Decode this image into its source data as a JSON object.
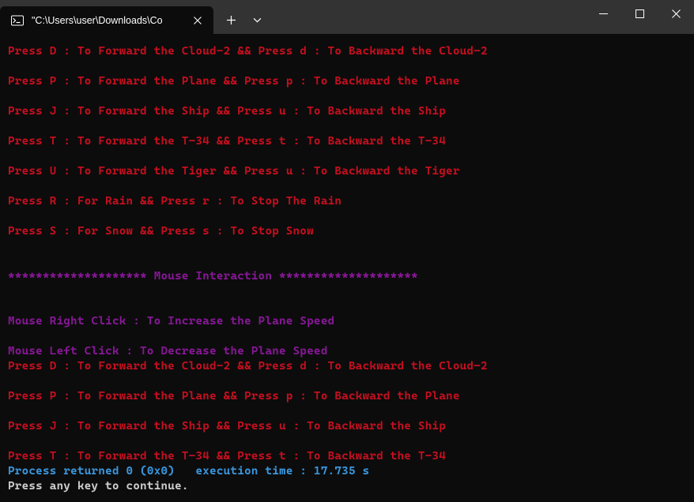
{
  "titlebar": {
    "tab_title": "\"C:\\Users\\user\\Downloads\\Co"
  },
  "terminal": {
    "lines": [
      {
        "cls": "red",
        "text": "Press D : To Forward the Cloud-2 && Press d : To Backward the Cloud-2"
      },
      {
        "cls": "spacer",
        "text": ""
      },
      {
        "cls": "red",
        "text": "Press P : To Forward the Plane && Press p : To Backward the Plane"
      },
      {
        "cls": "spacer",
        "text": ""
      },
      {
        "cls": "red",
        "text": "Press J : To Forward the Ship && Press u : To Backward the Ship"
      },
      {
        "cls": "spacer",
        "text": ""
      },
      {
        "cls": "red",
        "text": "Press T : To Forward the T-34 && Press t : To Backward the T-34"
      },
      {
        "cls": "spacer",
        "text": ""
      },
      {
        "cls": "red",
        "text": "Press U : To Forward the Tiger && Press u : To Backward the Tiger"
      },
      {
        "cls": "spacer",
        "text": ""
      },
      {
        "cls": "red",
        "text": "Press R : For Rain && Press r : To Stop The Rain"
      },
      {
        "cls": "spacer",
        "text": ""
      },
      {
        "cls": "red",
        "text": "Press S : For Snow && Press s : To Stop Snow"
      },
      {
        "cls": "spacer",
        "text": ""
      },
      {
        "cls": "spacer",
        "text": ""
      },
      {
        "cls": "magenta",
        "text": "******************** Mouse Interaction ********************"
      },
      {
        "cls": "spacer",
        "text": ""
      },
      {
        "cls": "spacer",
        "text": ""
      },
      {
        "cls": "magenta",
        "text": "Mouse Right Click : To Increase the Plane Speed"
      },
      {
        "cls": "spacer",
        "text": ""
      },
      {
        "cls": "magenta",
        "text": "Mouse Left Click : To Decrease the Plane Speed"
      },
      {
        "cls": "red",
        "text": "Press D : To Forward the Cloud-2 && Press d : To Backward the Cloud-2"
      },
      {
        "cls": "spacer",
        "text": ""
      },
      {
        "cls": "red",
        "text": "Press P : To Forward the Plane && Press p : To Backward the Plane"
      },
      {
        "cls": "spacer",
        "text": ""
      },
      {
        "cls": "red",
        "text": "Press J : To Forward the Ship && Press u : To Backward the Ship"
      },
      {
        "cls": "spacer",
        "text": ""
      },
      {
        "cls": "red",
        "text": "Press T : To Forward the T-34 && Press t : To Backward the T-34"
      },
      {
        "cls": "cyan",
        "text": "Process returned 0 (0x0)   execution time : 17.735 s"
      },
      {
        "cls": "white",
        "text": "Press any key to continue."
      }
    ]
  }
}
